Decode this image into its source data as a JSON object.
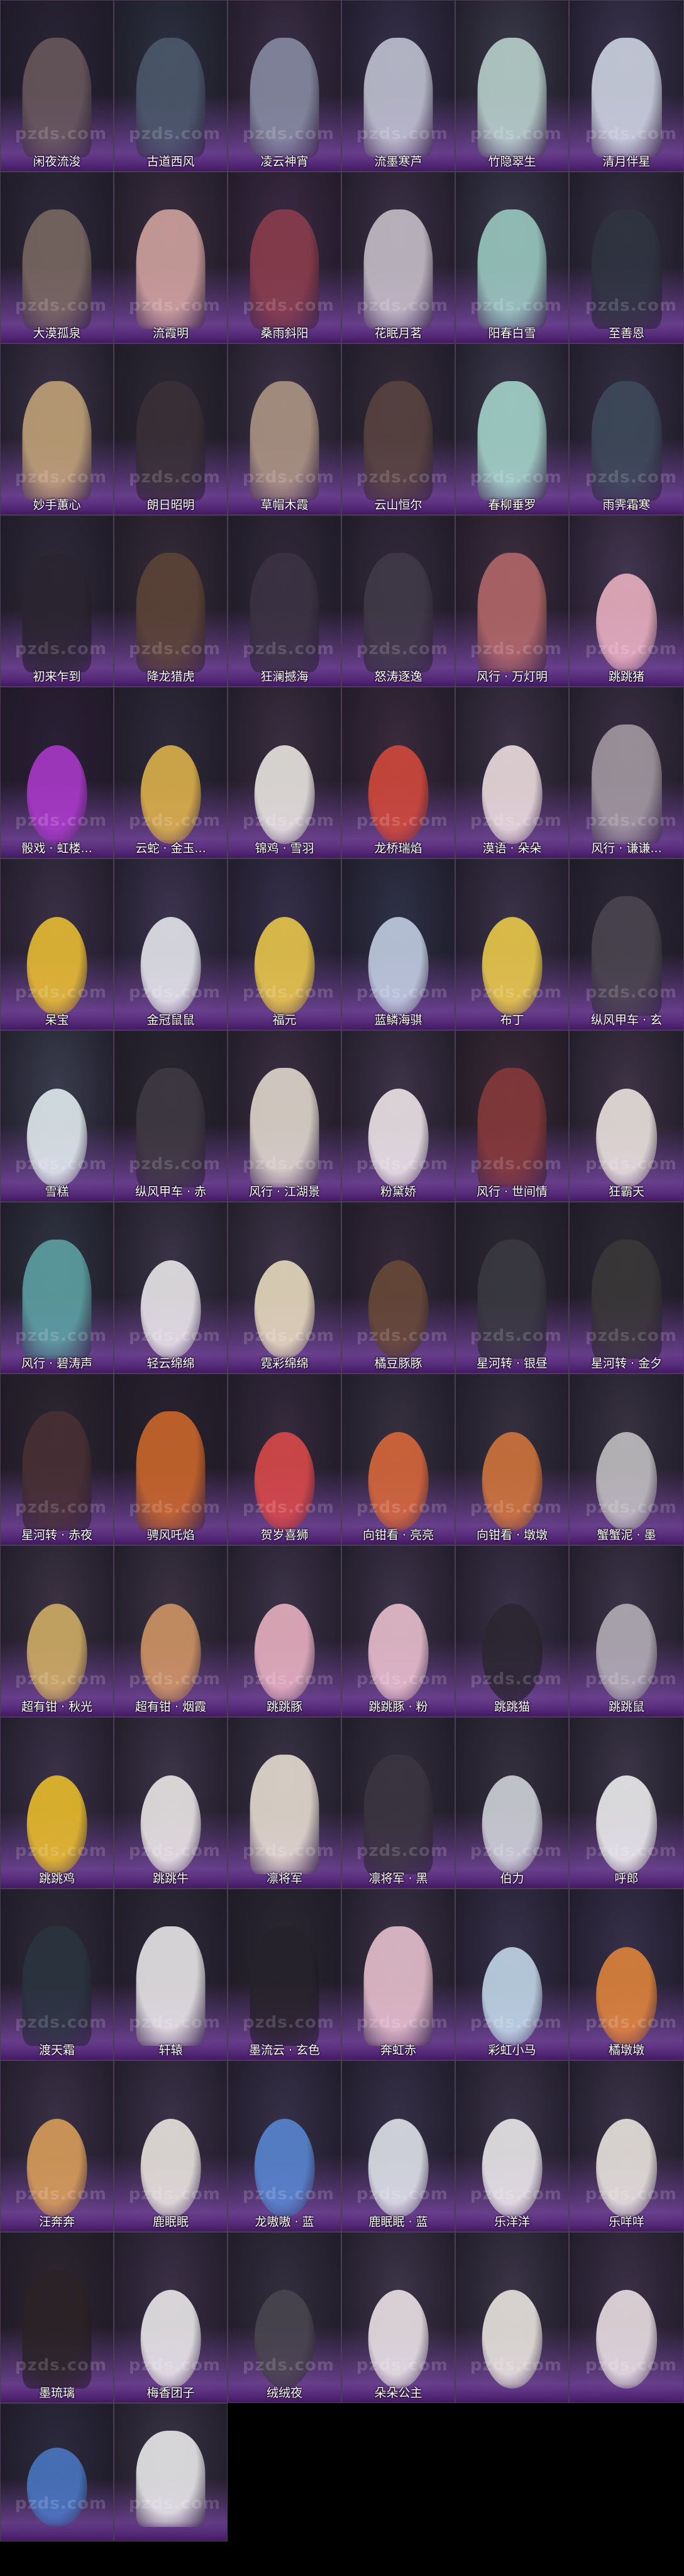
{
  "watermark": "pzds.com",
  "colors": {
    "background": "#000000",
    "cell_gradient": "#8c50be",
    "label_text": "#ffffff",
    "cell_border": "#4a3d55"
  },
  "grid": {
    "columns": 6,
    "items": [
      {
        "label": "闲夜流浚",
        "kind": "character",
        "tone": "#2a2436",
        "figure": "#6b5a5e"
      },
      {
        "label": "古道西风",
        "kind": "character",
        "tone": "#2c3140",
        "figure": "#4d5a6e"
      },
      {
        "label": "凌云神宵",
        "kind": "character",
        "tone": "#3a2f46",
        "figure": "#8a8fa6"
      },
      {
        "label": "流墨寒芦",
        "kind": "character",
        "tone": "#35304a",
        "figure": "#c7c9d8"
      },
      {
        "label": "竹隐翠生",
        "kind": "character",
        "tone": "#3a3a4a",
        "figure": "#bfd9d2"
      },
      {
        "label": "清月伴星",
        "kind": "character",
        "tone": "#3b3550",
        "figure": "#d5dce8"
      },
      {
        "label": "大漠孤泉",
        "kind": "character",
        "tone": "#2e2a3b",
        "figure": "#7d6b63"
      },
      {
        "label": "流霞明",
        "kind": "character",
        "tone": "#3a2e3e",
        "figure": "#d9a9a4"
      },
      {
        "label": "桑雨斜阳",
        "kind": "character",
        "tone": "#3d2a44",
        "figure": "#8d3d4b"
      },
      {
        "label": "花眠月茗",
        "kind": "character",
        "tone": "#3b3146",
        "figure": "#cdc6cf"
      },
      {
        "label": "阳春白雪",
        "kind": "character",
        "tone": "#3a3a4c",
        "figure": "#9fd0c6"
      },
      {
        "label": "至善恩",
        "kind": "character",
        "tone": "#333042",
        "figure": "#2f3440"
      },
      {
        "label": "妙手蕙心",
        "kind": "character",
        "tone": "#3a3346",
        "figure": "#c8a87a"
      },
      {
        "label": "朗日昭明",
        "kind": "character",
        "tone": "#2c2834",
        "figure": "#3a3036"
      },
      {
        "label": "草帽木霞",
        "kind": "character",
        "tone": "#3d3448",
        "figure": "#b29a86"
      },
      {
        "label": "云山恒尔",
        "kind": "character",
        "tone": "#332c3a",
        "figure": "#5a4540"
      },
      {
        "label": "春柳垂罗",
        "kind": "character",
        "tone": "#3c3a4d",
        "figure": "#a9dcd0"
      },
      {
        "label": "雨霁霜寒",
        "kind": "character",
        "tone": "#343044",
        "figure": "#3d4a5a"
      },
      {
        "label": "初来乍到",
        "kind": "character",
        "tone": "#2f2a3a",
        "figure": "#2a2430"
      },
      {
        "label": "降龙猎虎",
        "kind": "character",
        "tone": "#342c38",
        "figure": "#5e4436"
      },
      {
        "label": "狂澜撼海",
        "kind": "character",
        "tone": "#30293a",
        "figure": "#3b3343"
      },
      {
        "label": "怒涛逐逸",
        "kind": "character",
        "tone": "#322a3c",
        "figure": "#403a48"
      },
      {
        "label": "风行 · 万灯明",
        "kind": "board",
        "tone": "#3c2d3e",
        "figure": "#b86a6a"
      },
      {
        "label": "跳跳猪",
        "kind": "pet",
        "tone": "#433650",
        "figure": "#f2b7c6"
      },
      {
        "label": "骰戏 · 虹楼...",
        "kind": "item",
        "tone": "#2b2036",
        "figure": "#b03ad0"
      },
      {
        "label": "云蛇 · 金玉...",
        "kind": "pet",
        "tone": "#2f2a3a",
        "figure": "#e6b84a"
      },
      {
        "label": "锦鸡 · 雪羽",
        "kind": "pet",
        "tone": "#3a2e40",
        "figure": "#f1efe8"
      },
      {
        "label": "龙桥瑞焰",
        "kind": "pet",
        "tone": "#3a2a3c",
        "figure": "#d94a3a"
      },
      {
        "label": "漠语 · 朵朵",
        "kind": "pet",
        "tone": "#3c3346",
        "figure": "#f5e6e6"
      },
      {
        "label": "风行 · 谦谦...",
        "kind": "board",
        "tone": "#3a3144",
        "figure": "#a89ea6"
      },
      {
        "label": "呆宝",
        "kind": "pet",
        "tone": "#3a3046",
        "figure": "#f2c431"
      },
      {
        "label": "金冠鼠鼠",
        "kind": "pet",
        "tone": "#3c3450",
        "figure": "#eef0f4"
      },
      {
        "label": "福元",
        "kind": "pet",
        "tone": "#35304a",
        "figure": "#f2cf4a"
      },
      {
        "label": "蓝鳞海骐",
        "kind": "pet",
        "tone": "#2e3146",
        "figure": "#c9d6ea"
      },
      {
        "label": "布丁",
        "kind": "pet",
        "tone": "#3a3248",
        "figure": "#f4d24a"
      },
      {
        "label": "纵风甲车 · 玄",
        "kind": "board",
        "tone": "#2c2836",
        "figure": "#4b4650"
      },
      {
        "label": "雪糕",
        "kind": "pet",
        "tone": "#3a3d4e",
        "figure": "#eaf4f6"
      },
      {
        "label": "纵风甲车 · 赤",
        "kind": "board",
        "tone": "#2a2632",
        "figure": "#3f3a42"
      },
      {
        "label": "风行 · 江湖景",
        "kind": "board",
        "tone": "#3a3042",
        "figure": "#e9e1d4"
      },
      {
        "label": "粉黛娇",
        "kind": "pet",
        "tone": "#3d3448",
        "figure": "#f7eef0"
      },
      {
        "label": "风行 · 世间情",
        "kind": "board",
        "tone": "#3a2a36",
        "figure": "#8a3a3a"
      },
      {
        "label": "狂霸天",
        "kind": "pet",
        "tone": "#3d3446",
        "figure": "#f4ece6"
      },
      {
        "label": "风行 · 碧涛声",
        "kind": "board",
        "tone": "#2f3442",
        "figure": "#5fa6a8"
      },
      {
        "label": "轻云绵绵",
        "kind": "pet",
        "tone": "#3a3446",
        "figure": "#f3f0f2"
      },
      {
        "label": "霓彩绵绵",
        "kind": "pet",
        "tone": "#3d3548",
        "figure": "#f0e3c4"
      },
      {
        "label": "橘豆豚豚",
        "kind": "pet",
        "tone": "#33293a",
        "figure": "#6a4a36"
      },
      {
        "label": "星河转 · 银昼",
        "kind": "mount",
        "tone": "#2c2834",
        "figure": "#3a3a42"
      },
      {
        "label": "星河转 · 金夕",
        "kind": "mount",
        "tone": "#2c2834",
        "figure": "#3a3838"
      },
      {
        "label": "星河转 · 赤夜",
        "kind": "mount",
        "tone": "#2c2630",
        "figure": "#4a3034"
      },
      {
        "label": "骋风吒焰",
        "kind": "mount",
        "tone": "#2a2230",
        "figure": "#d36a2a"
      },
      {
        "label": "贺岁喜狮",
        "kind": "pet",
        "tone": "#342a3c",
        "figure": "#e24a4a"
      },
      {
        "label": "向钳看 · 亮亮",
        "kind": "pet",
        "tone": "#36303e",
        "figure": "#e06a3a"
      },
      {
        "label": "向钳看 · 墩墩",
        "kind": "pet",
        "tone": "#36303e",
        "figure": "#d8783a"
      },
      {
        "label": "蟹蟹泥 · 墨",
        "kind": "pet",
        "tone": "#383240",
        "figure": "#c8c6c8"
      },
      {
        "label": "超有钳 · 秋光",
        "kind": "pet",
        "tone": "#3a3242",
        "figure": "#d8b466"
      },
      {
        "label": "超有钳 · 烟霞",
        "kind": "pet",
        "tone": "#3a3242",
        "figure": "#d89a66"
      },
      {
        "label": "跳跳豚",
        "kind": "pet",
        "tone": "#3c3348",
        "figure": "#f0b7c6"
      },
      {
        "label": "跳跳豚 · 粉",
        "kind": "pet",
        "tone": "#3c3348",
        "figure": "#f3c6d4"
      },
      {
        "label": "跳跳猫",
        "kind": "pet",
        "tone": "#3a3248",
        "figure": "#2a2630"
      },
      {
        "label": "跳跳鼠",
        "kind": "pet",
        "tone": "#3c3448",
        "figure": "#b9b4bc"
      },
      {
        "label": "跳跳鸡",
        "kind": "pet",
        "tone": "#3a3248",
        "figure": "#f2c42a"
      },
      {
        "label": "跳跳牛",
        "kind": "pet",
        "tone": "#3c3448",
        "figure": "#f4f0ee"
      },
      {
        "label": "凛将军",
        "kind": "mount",
        "tone": "#3a3446",
        "figure": "#efe6d8"
      },
      {
        "label": "凛将军 · 黑",
        "kind": "mount",
        "tone": "#332e3c",
        "figure": "#3a3540"
      },
      {
        "label": "伯力",
        "kind": "pet",
        "tone": "#35303e",
        "figure": "#d8dbe2"
      },
      {
        "label": "呼郎",
        "kind": "pet",
        "tone": "#3b3547",
        "figure": "#f6f6f6"
      },
      {
        "label": "渡天霜",
        "kind": "mount",
        "tone": "#2e2a38",
        "figure": "#2a3440"
      },
      {
        "label": "轩辕",
        "kind": "mount",
        "tone": "#2e2a38",
        "figure": "#f2f0f0"
      },
      {
        "label": "墨流云 · 玄色",
        "kind": "mount",
        "tone": "#2a2632",
        "figure": "#26222a"
      },
      {
        "label": "奔虹赤",
        "kind": "mount",
        "tone": "#3a3246",
        "figure": "#f0c8d4"
      },
      {
        "label": "彩虹小马",
        "kind": "pet",
        "tone": "#36314a",
        "figure": "#c8e0f0"
      },
      {
        "label": "橘墩墩",
        "kind": "pet",
        "tone": "#36304a",
        "figure": "#e8883a"
      },
      {
        "label": "汪奔奔",
        "kind": "pet",
        "tone": "#3a3046",
        "figure": "#e2a45a"
      },
      {
        "label": "鹿眠眠",
        "kind": "pet",
        "tone": "#3a3248",
        "figure": "#f2eee6"
      },
      {
        "label": "龙嗷嗷 · 蓝",
        "kind": "pet",
        "tone": "#363048",
        "figure": "#5a8ad8"
      },
      {
        "label": "鹿眠眠 · 蓝",
        "kind": "pet",
        "tone": "#363048",
        "figure": "#e8ecf2"
      },
      {
        "label": "乐洋洋",
        "kind": "pet",
        "tone": "#3a3348",
        "figure": "#f4f2f2"
      },
      {
        "label": "乐咩咩",
        "kind": "pet",
        "tone": "#3a3348",
        "figure": "#f2eee6"
      },
      {
        "label": "墨琉璃",
        "kind": "mount",
        "tone": "#2c2630",
        "figure": "#2a2224"
      },
      {
        "label": "梅香团子",
        "kind": "pet",
        "tone": "#3a3046",
        "figure": "#f4f2f2"
      },
      {
        "label": "绒绒夜",
        "kind": "pet",
        "tone": "#332e3e",
        "figure": "#4a4650"
      },
      {
        "label": "朵朵公主",
        "kind": "pet",
        "tone": "#3c3448",
        "figure": "#f4ecee"
      },
      {
        "label": "",
        "kind": "pet",
        "tone": "#3a3446",
        "figure": "#f2eee6"
      },
      {
        "label": "",
        "kind": "pet",
        "tone": "#3a3046",
        "figure": "#f2e8ea"
      },
      {
        "label": "",
        "kind": "pet",
        "tone": "#2c2a3e",
        "figure": "#4a7ac8"
      },
      {
        "label": "",
        "kind": "mount",
        "tone": "#3a3446",
        "figure": "#f2f2f2"
      }
    ]
  }
}
